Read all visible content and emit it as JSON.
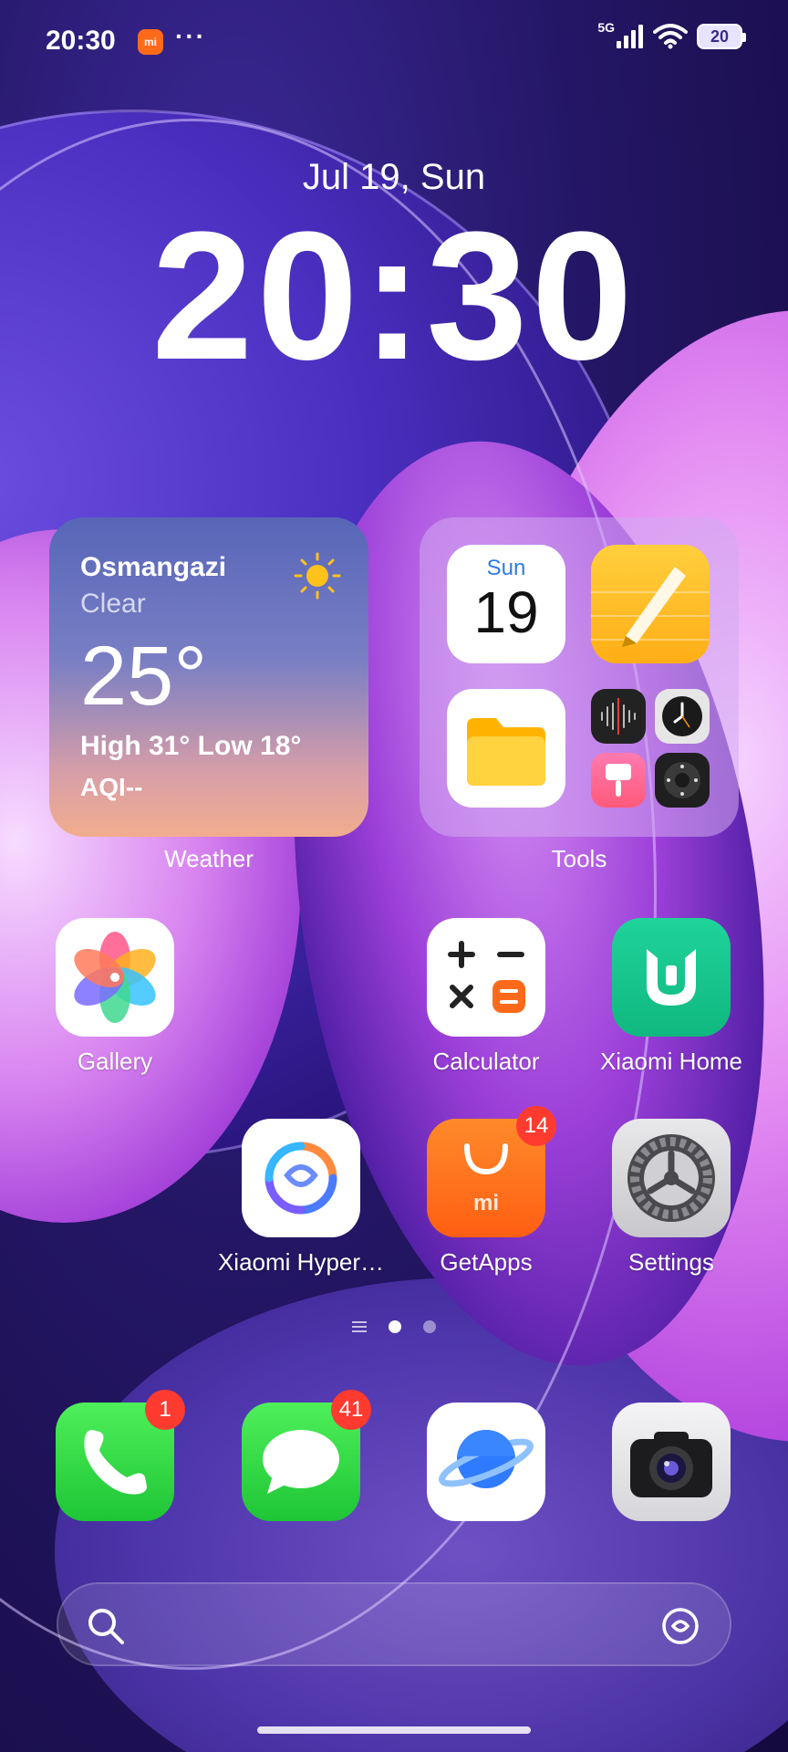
{
  "status_bar": {
    "time": "20:30",
    "notification_icon": "mi-store-icon",
    "more": "···",
    "network": "5G",
    "battery": "20"
  },
  "lockclock": {
    "date": "Jul 19, Sun",
    "time": "20:30"
  },
  "weather_widget": {
    "city": "Osmangazi",
    "condition": "Clear",
    "temperature": "25°",
    "high_low": "High 31° Low 18°",
    "aqi": "AQI--",
    "label": "Weather"
  },
  "tools_folder": {
    "label": "Tools",
    "calendar_day": "Sun",
    "calendar_date": "19"
  },
  "apps": {
    "gallery": "Gallery",
    "calculator": "Calculator",
    "xiaomi_home": "Xiaomi Home",
    "xiaomi_hyper": "Xiaomi Hyper…",
    "getapps": "GetApps",
    "getapps_badge": "14",
    "settings": "Settings"
  },
  "dock": {
    "phone_badge": "1",
    "messages_badge": "41"
  },
  "colors": {
    "accent_badge": "#ff3b30",
    "mi_orange": "#ff6a1a"
  }
}
